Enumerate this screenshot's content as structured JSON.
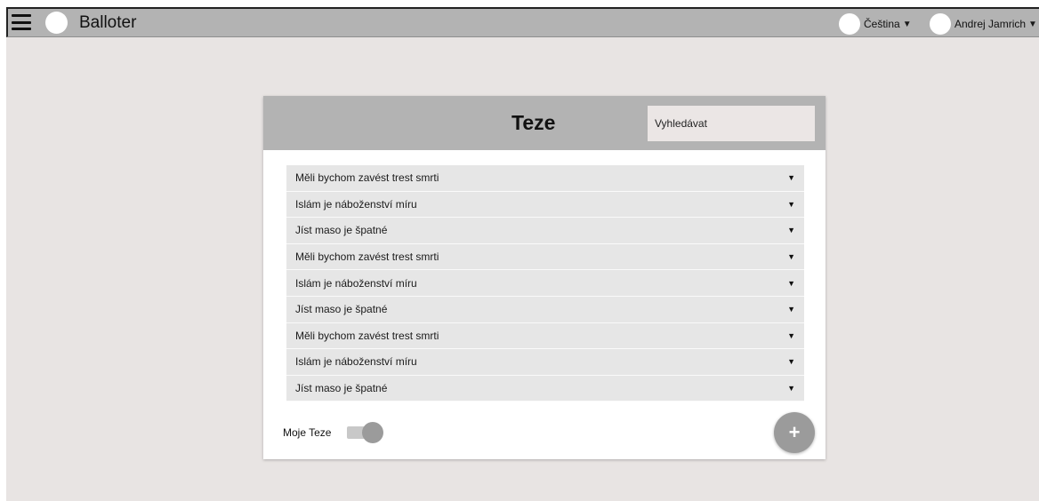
{
  "app": {
    "title": "Balloter"
  },
  "header": {
    "language": {
      "label": "Čeština",
      "caret": "▼"
    },
    "user": {
      "name": "Andrej Jamrich",
      "caret": "▼"
    }
  },
  "card": {
    "title": "Teze",
    "search_placeholder": "Vyhledávat",
    "rows": [
      {
        "label": "Měli bychom zavést trest smrti",
        "arrow": "▼"
      },
      {
        "label": "Islám je náboženství míru",
        "arrow": "▼"
      },
      {
        "label": "Jíst maso je špatné",
        "arrow": "▼"
      },
      {
        "label": "Měli bychom zavést trest smrti",
        "arrow": "▼"
      },
      {
        "label": "Islám je náboženství míru",
        "arrow": "▼"
      },
      {
        "label": "Jíst maso je špatné",
        "arrow": "▼"
      },
      {
        "label": "Měli bychom zavést trest smrti",
        "arrow": "▼"
      },
      {
        "label": "Islám je náboženství míru",
        "arrow": "▼"
      },
      {
        "label": "Jíst maso je špatné",
        "arrow": "▼"
      }
    ],
    "toggle_label": "Moje Teze",
    "toggle_on": true,
    "fab_label": "+"
  },
  "icons": {
    "menu": "hamburger-menu-icon",
    "logo": "logo-circle-icon",
    "language": "language-circle-icon",
    "avatar": "user-avatar-icon",
    "row_arrow": "triangle-down-icon",
    "add": "plus-icon"
  },
  "colors": {
    "topbar": "#b3b3b3",
    "background": "#e8e4e3",
    "card_header": "#b3b3b3",
    "row": "#e6e6e6",
    "fab": "#9b9b9b"
  }
}
